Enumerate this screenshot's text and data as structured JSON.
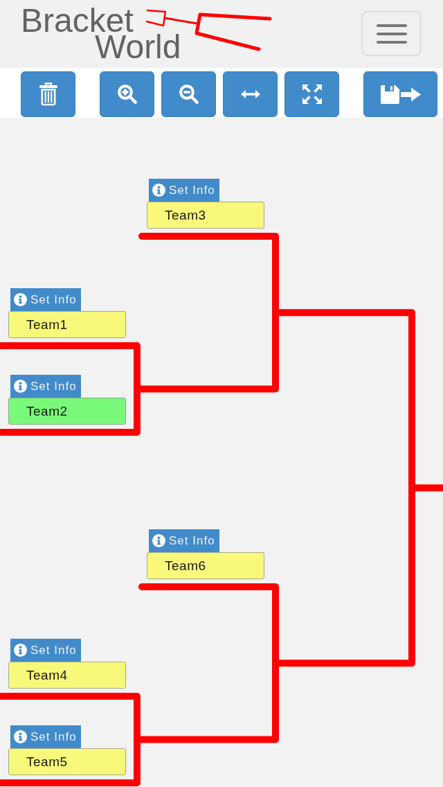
{
  "header": {
    "logo": {
      "lines": [
        "Bracket",
        "World"
      ]
    }
  },
  "toolbar": {
    "groups": [
      {
        "buttons": [
          {
            "kind": "delete"
          }
        ]
      },
      {
        "buttons": [
          {
            "kind": "zoom_in"
          },
          {
            "kind": "zoom_out"
          },
          {
            "kind": "fit_width"
          },
          {
            "kind": "fullscreen"
          }
        ]
      },
      {
        "buttons": [
          {
            "kind": "save"
          }
        ]
      }
    ]
  },
  "bracket": {
    "kind": "match",
    "children": [
      {
        "kind": "match",
        "children": [
          {
            "kind": "team",
            "info_label": "Set Info",
            "name": "Team3",
            "selected": false
          },
          {
            "kind": "match",
            "children": [
              {
                "kind": "team",
                "info_label": "Set Info",
                "name": "Team1",
                "selected": false
              },
              {
                "kind": "team",
                "info_label": "Set Info",
                "name": "Team2",
                "selected": true
              }
            ]
          }
        ]
      },
      {
        "kind": "match",
        "children": [
          {
            "kind": "team",
            "info_label": "Set Info",
            "name": "Team6",
            "selected": false
          },
          {
            "kind": "match",
            "children": [
              {
                "kind": "team",
                "info_label": "Set Info",
                "name": "Team4",
                "selected": false
              },
              {
                "kind": "team",
                "info_label": "Set Info",
                "name": "Team5",
                "selected": false
              }
            ]
          }
        ]
      }
    ]
  }
}
